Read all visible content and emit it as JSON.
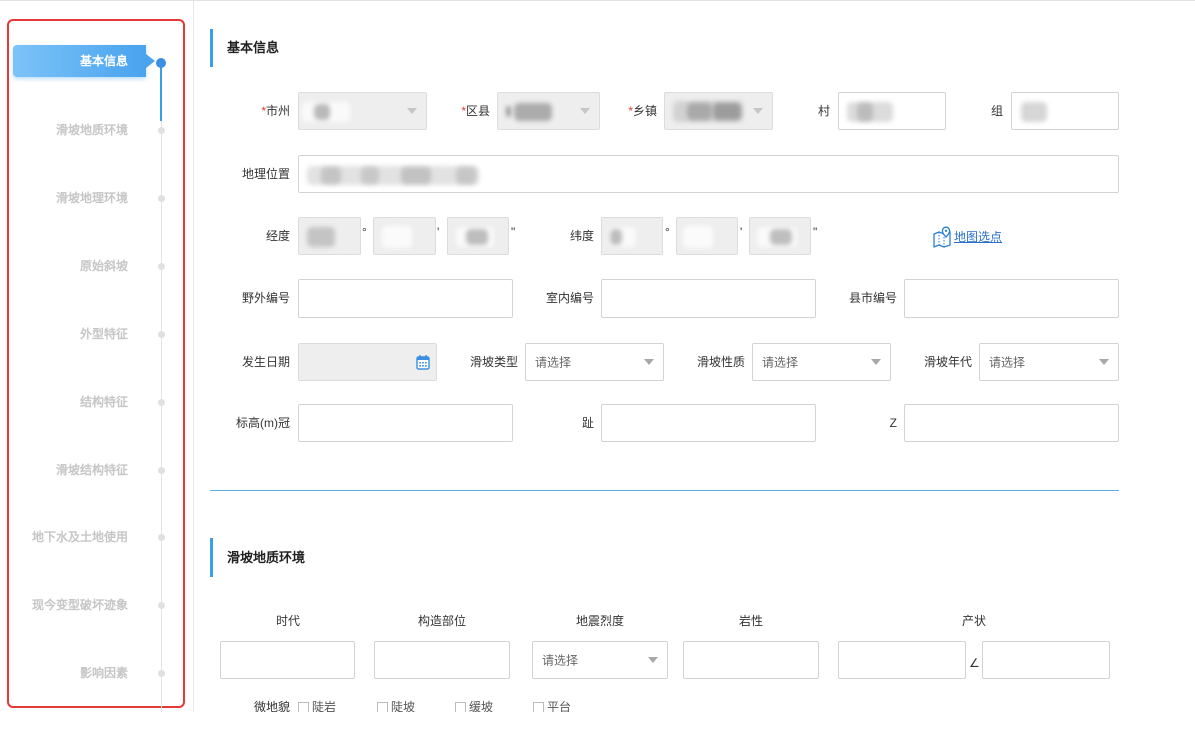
{
  "colors": {
    "accent": "#3a9fe6",
    "highlight_box": "#e53935",
    "required": "#e53935",
    "link": "#2a6fc9",
    "sidebar_inactive_text": "#c6c6c6"
  },
  "icons": {
    "calendar": "calendar-icon",
    "map_pick": "map-pin-icon",
    "dropdown": "chevron-down-icon"
  },
  "sidebar": {
    "active_index": 0,
    "items": [
      {
        "label": "基本信息"
      },
      {
        "label": "滑坡地质环境"
      },
      {
        "label": "滑坡地理环境"
      },
      {
        "label": "原始斜坡"
      },
      {
        "label": "外型特征"
      },
      {
        "label": "结构特征"
      },
      {
        "label": "滑坡结构特征"
      },
      {
        "label": "地下水及土地使用"
      },
      {
        "label": "现今变型破坏迹象"
      },
      {
        "label": "影响因素"
      }
    ]
  },
  "basic_info": {
    "title": "基本信息",
    "required_mark": "*",
    "labels": {
      "city": "市州",
      "district": "区县",
      "town": "乡镇",
      "village": "村",
      "group": "组",
      "location": "地理位置",
      "longitude": "经度",
      "latitude": "纬度",
      "field_no": "野外编号",
      "indoor_no": "室内编号",
      "county_no": "县市编号",
      "date": "发生日期",
      "type": "滑坡类型",
      "nature": "滑坡性质",
      "era": "滑坡年代",
      "elev_crown": "标高(m)冠",
      "elev_toe": "趾",
      "elev_z": "Z"
    },
    "units": {
      "degree": "°",
      "minute": "'",
      "second": "\""
    },
    "map_pick_link": "地图选点",
    "select_placeholder": "请选择"
  },
  "geology_env": {
    "title": "滑坡地质环境",
    "columns": [
      "时代",
      "构造部位",
      "地震烈度",
      "岩性",
      "产状"
    ],
    "select_placeholder": "请选择",
    "angle_symbol": "∠",
    "micro_landform": {
      "label": "微地貌",
      "options": [
        "陡岩",
        "陡坡",
        "缓坡",
        "平台"
      ]
    }
  }
}
